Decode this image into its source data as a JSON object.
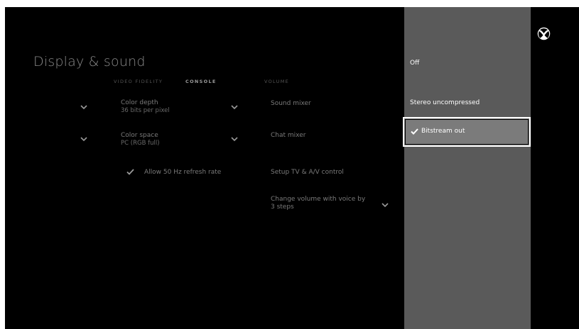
{
  "page": {
    "title": "Display & sound"
  },
  "tabs": [
    {
      "label": "VIDEO FIDELITY",
      "active": false
    },
    {
      "label": "CONSOLE",
      "active": true
    },
    {
      "label": "VOLUME",
      "active": false
    }
  ],
  "video": {
    "color_depth": {
      "label": "Color depth",
      "value": "36 bits per pixel"
    },
    "color_space": {
      "label": "Color space",
      "value": "PC (RGB full)"
    },
    "refresh": {
      "label": "Allow 50 Hz refresh rate",
      "checked": true
    }
  },
  "volume": {
    "sound_mixer": "Sound mixer",
    "chat_mixer": "Chat mixer",
    "setup_tv": "Setup TV & A/V control",
    "voice_volume": {
      "line1": "Change volume with voice by",
      "line2": "3 steps"
    }
  },
  "options_panel": {
    "options": [
      "Off",
      "Stereo uncompressed",
      "Bitstream out"
    ],
    "selected": "Bitstream out"
  },
  "colors": {
    "background": "#000000",
    "panel": "#5a5a5a",
    "selection": "#7b7b7b",
    "text": "#ffffff"
  },
  "icons": {
    "logo": "xbox-logo-icon",
    "chevron": "chevron-down-icon",
    "check": "checkmark-icon"
  }
}
